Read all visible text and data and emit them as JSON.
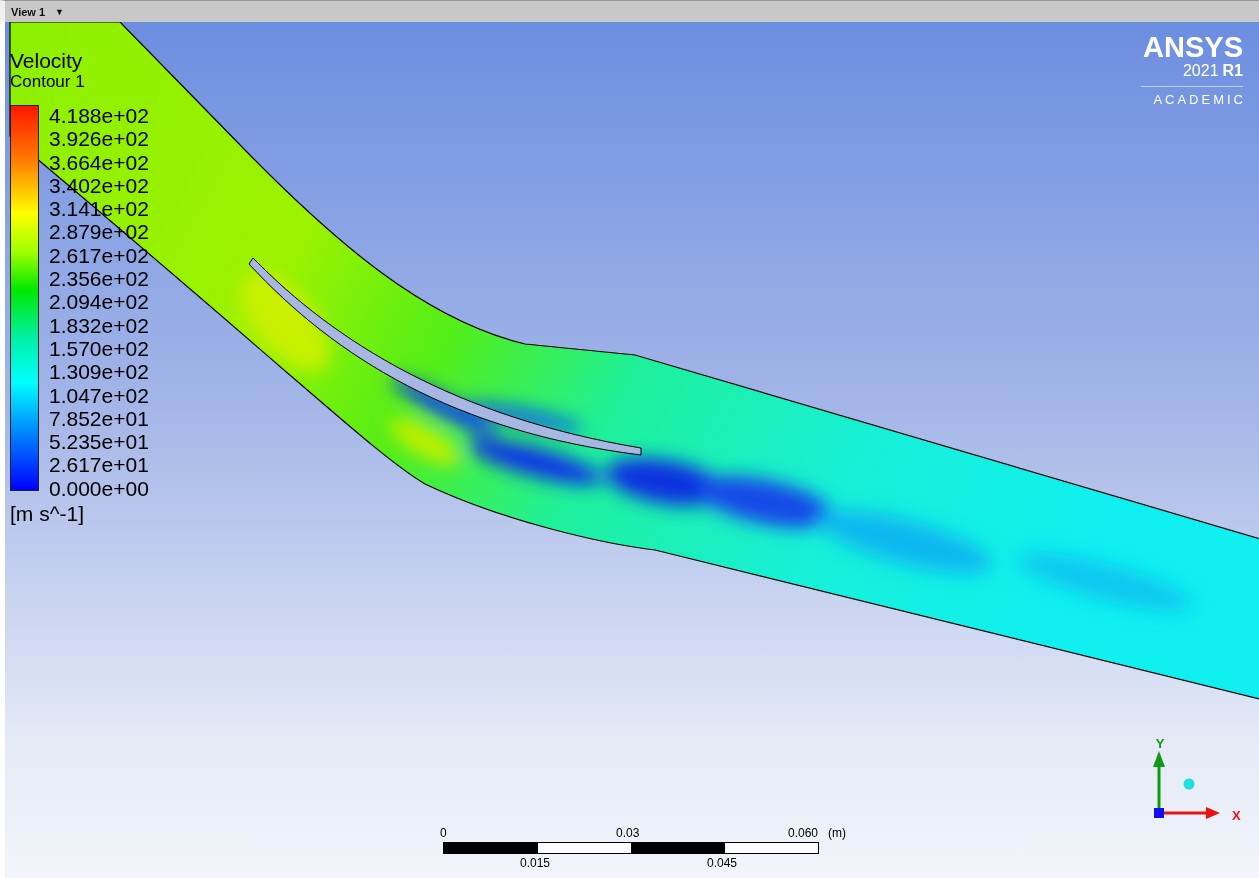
{
  "toolbar": {
    "view_label": "View 1",
    "dropdown_glyph": "▼"
  },
  "legend": {
    "title": "Velocity",
    "subtitle": "Contour 1",
    "levels": [
      "4.188e+02",
      "3.926e+02",
      "3.664e+02",
      "3.402e+02",
      "3.141e+02",
      "2.879e+02",
      "2.617e+02",
      "2.356e+02",
      "2.094e+02",
      "1.832e+02",
      "1.570e+02",
      "1.309e+02",
      "1.047e+02",
      "7.852e+01",
      "5.235e+01",
      "2.617e+01",
      "0.000e+00"
    ],
    "unit": "[m s^-1]"
  },
  "logo": {
    "brand": "ANSYS",
    "version": "2021",
    "release": "R1",
    "edition": "ACADEMIC"
  },
  "triad": {
    "y_label": "Y",
    "x_label": "X"
  },
  "scale_bar": {
    "top_labels": [
      "0",
      "0.03",
      "0.060"
    ],
    "unit": "(m)",
    "bottom_labels": [
      "0.015",
      "0.045"
    ]
  }
}
